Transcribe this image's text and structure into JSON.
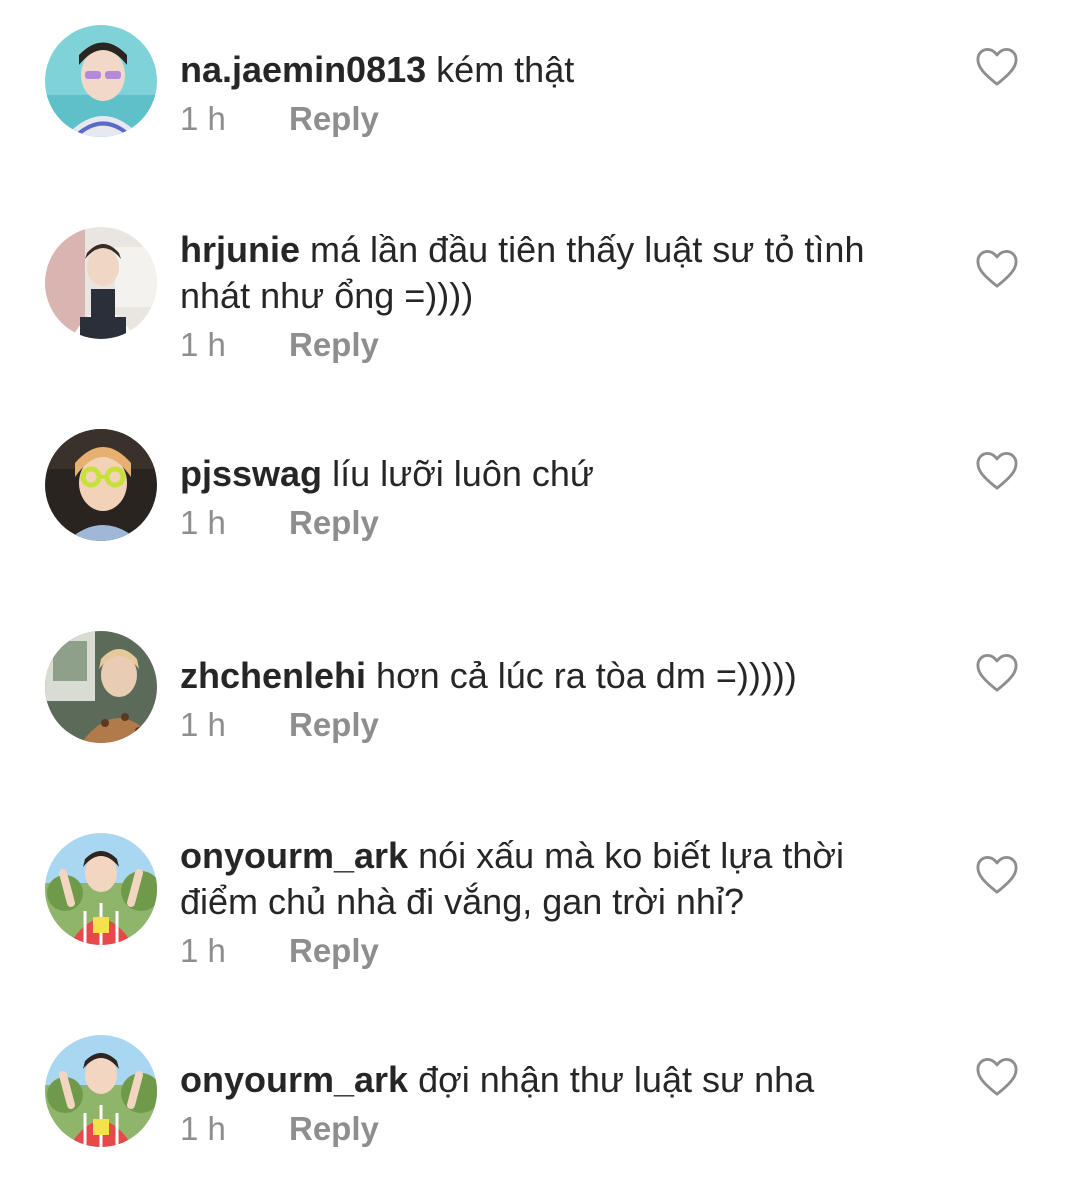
{
  "comments": [
    {
      "username": "na.jaemin0813",
      "text": "kém thật",
      "time": "1 h",
      "reply_label": "Reply",
      "avatar": {
        "bg": "#7fd3d8",
        "accent": "#b48ad8",
        "skin": "#f1d8c8"
      }
    },
    {
      "username": "hrjunie",
      "text": "má lần đầu tiên thấy luật sư tỏ tình nhát như ổng =))))",
      "time": "1 h",
      "reply_label": "Reply",
      "avatar": {
        "bg": "#e9e6e1",
        "accent": "#2a2f3a",
        "skin": "#f0d6c4"
      }
    },
    {
      "username": "pjsswag",
      "text": "líu lưỡi luôn chứ",
      "time": "1 h",
      "reply_label": "Reply",
      "avatar": {
        "bg": "#2a2420",
        "accent": "#c8e03a",
        "skin": "#f2d2b8"
      }
    },
    {
      "username": "zhchenlehi",
      "text": "hơn cả lúc ra tòa dm =)))))",
      "time": "1 h",
      "reply_label": "Reply",
      "avatar": {
        "bg": "#5c6a5a",
        "accent": "#b07a4a",
        "skin": "#e8cdb4"
      }
    },
    {
      "username": "onyourm_ark",
      "text": "nói xấu mà ko biết lựa thời điểm chủ nhà đi vắng, gan trời nhỉ?",
      "time": "1 h",
      "reply_label": "Reply",
      "avatar": {
        "bg": "#8fb56a",
        "accent": "#e8484a",
        "skin": "#f3d6c2"
      }
    },
    {
      "username": "onyourm_ark",
      "text": "đợi nhận thư luật sư nha",
      "time": "1 h",
      "reply_label": "Reply",
      "avatar": {
        "bg": "#8fb56a",
        "accent": "#e8484a",
        "skin": "#f3d6c2"
      }
    }
  ]
}
